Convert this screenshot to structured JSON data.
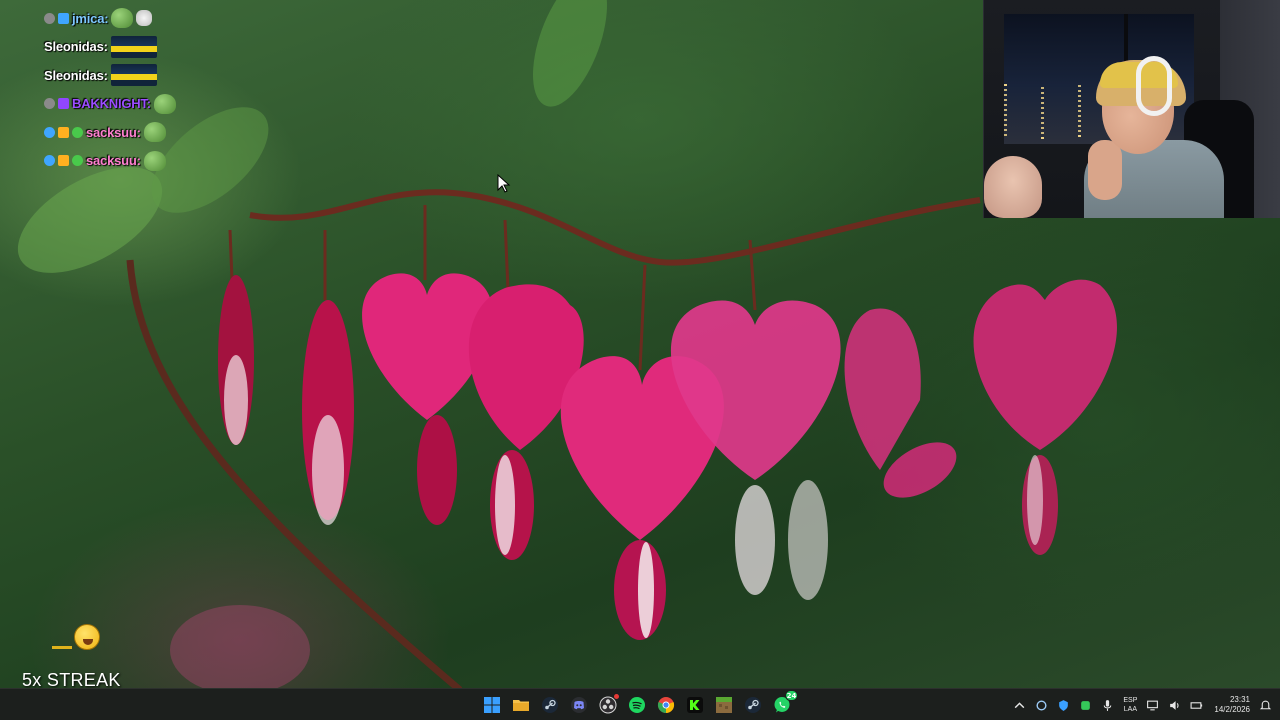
{
  "chat": {
    "messages": [
      {
        "user": "jmica:",
        "color": "#7ec8ff",
        "badges": [
          "#8a8a8a",
          "#3fa6ff"
        ],
        "emotes": [
          "pepe",
          "hands"
        ]
      },
      {
        "user": "Sleonidas:",
        "color": "#ffffff",
        "badges": [],
        "emotes": [
          "car"
        ]
      },
      {
        "user": "Sleonidas:",
        "color": "#ffffff",
        "badges": [],
        "emotes": [
          "car"
        ]
      },
      {
        "user": "BAKKNIGHT:",
        "color": "#9b4dff",
        "badges": [
          "#8a8a8a",
          "#9146ff"
        ],
        "emotes": [
          "pepe"
        ]
      },
      {
        "user": "sacksuu:",
        "color": "#ff7fd0",
        "badges": [
          "#3fa6ff",
          "#ffb020",
          "#49c94b"
        ],
        "emotes": [
          "pepe"
        ]
      },
      {
        "user": "sacksuu:",
        "color": "#ff7fd0",
        "badges": [
          "#3fa6ff",
          "#ffb020",
          "#49c94b"
        ],
        "emotes": [
          "pepe"
        ]
      }
    ]
  },
  "streak": {
    "label": "5x STREAK",
    "emoji": "laughing-emoji"
  },
  "taskbar": {
    "apps": [
      {
        "name": "start",
        "icon": "windows-icon",
        "color": "#3aa0ff"
      },
      {
        "name": "file-explorer",
        "icon": "folder-icon",
        "color": "#f4c04a"
      },
      {
        "name": "steam",
        "icon": "steam-icon",
        "color": "#c7d5e0"
      },
      {
        "name": "discord",
        "icon": "discord-icon",
        "color": "#7b86f5"
      },
      {
        "name": "obs",
        "icon": "obs-icon",
        "color": "#d6d6d6"
      },
      {
        "name": "spotify",
        "icon": "spotify-icon",
        "color": "#1ed760"
      },
      {
        "name": "chrome",
        "icon": "chrome-icon",
        "color": "#e8453c"
      },
      {
        "name": "kick",
        "icon": "kick-icon",
        "color": "#53fc18"
      },
      {
        "name": "minecraft",
        "icon": "minecraft-icon",
        "color": "#8b6b3e"
      },
      {
        "name": "steam-2",
        "icon": "steam-icon",
        "color": "#c7d5e0"
      },
      {
        "name": "whatsapp",
        "icon": "whatsapp-icon",
        "color": "#25d366",
        "badge": "24"
      }
    ],
    "tray": {
      "lang_top": "ESP",
      "lang_bottom": "LAA",
      "time": "23:31",
      "date": "14/2/2026"
    }
  }
}
